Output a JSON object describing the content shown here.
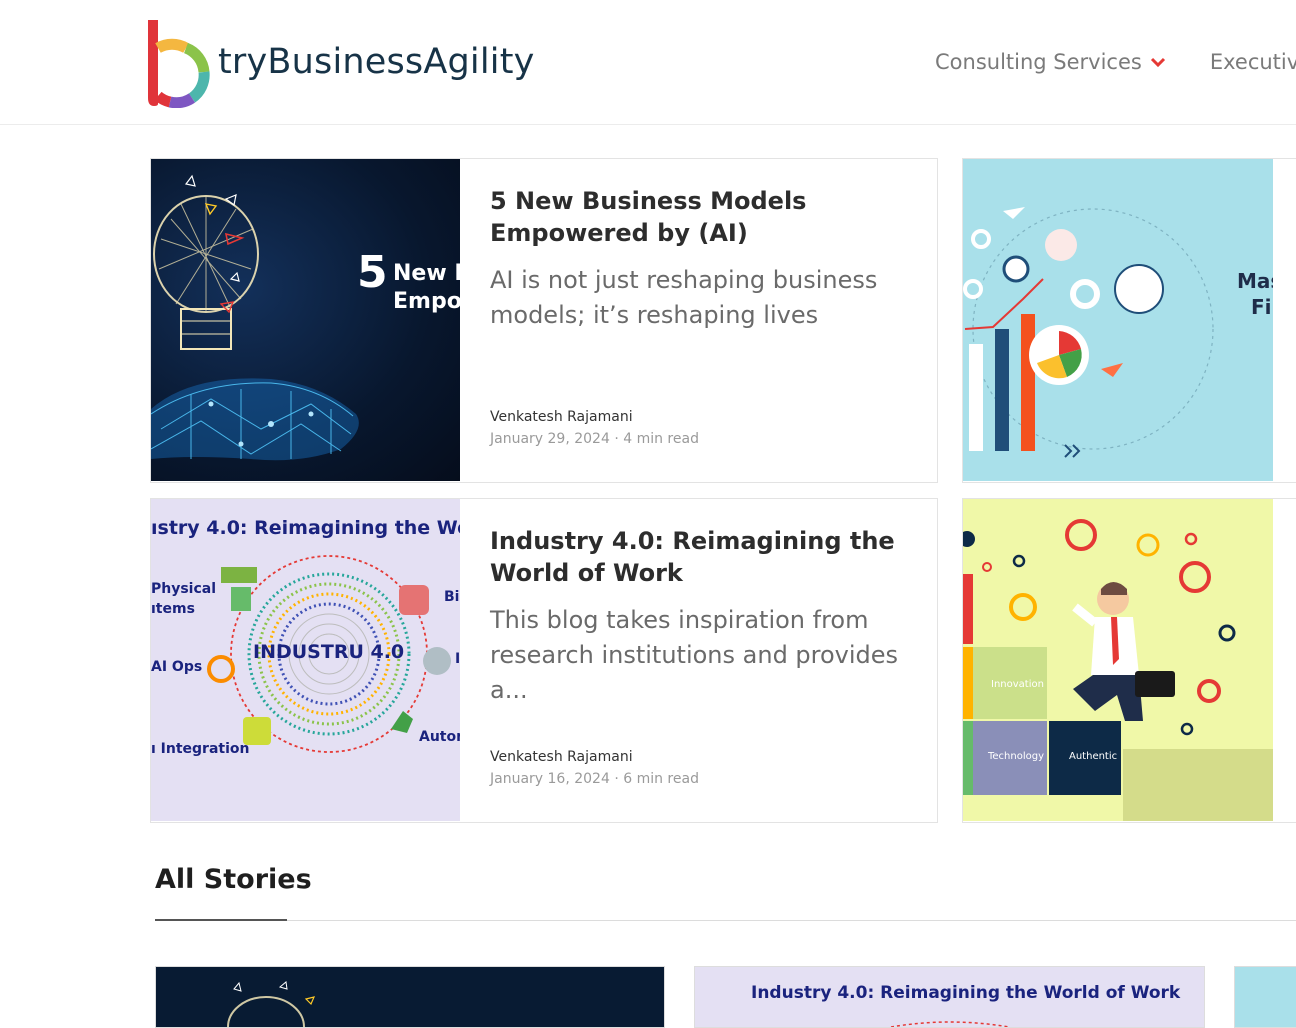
{
  "header": {
    "brand": "tryBusinessAgility",
    "nav": [
      {
        "label": "Consulting Services",
        "has_dropdown": true
      },
      {
        "label": "Executive E",
        "has_dropdown": false
      }
    ]
  },
  "featured": [
    {
      "title": "5 New Business Models Empowered by (AI)",
      "excerpt": "AI is not just reshaping business models; it’s reshaping lives",
      "author": "Venkatesh Rajamani",
      "meta": "January 29, 2024 · 4 min read",
      "thumb": {
        "number": "5",
        "line1": "New B",
        "line2": "Empow"
      }
    },
    {
      "title": "Industry 4.0: Reimagining the World of Work",
      "excerpt": "This blog takes inspiration from research institutions and provides a...",
      "author": "Venkatesh Rajamani",
      "meta": "January 16, 2024 · 6 min read",
      "thumb": {
        "heading": "ıstry 4.0: Reimagining the Wo",
        "center": "INDUSTRU 4.0",
        "labels": [
          "Physical",
          "ıtems",
          "AI Ops",
          "ı Integration",
          "Bi",
          "Auton",
          "I"
        ]
      }
    }
  ],
  "side_thumbs": [
    {
      "line1": "Mas",
      "line2": "Fi"
    },
    {
      "puzzle": [
        "Innovation",
        "Technology",
        "Authentic"
      ]
    }
  ],
  "all_stories": {
    "title": "All Stories",
    "cards": [
      {
        "thumb_text": ""
      },
      {
        "thumb_text": "Industry 4.0: Reimagining the World of Work"
      },
      {
        "thumb_text": ""
      }
    ]
  },
  "colors": {
    "brand_dark": "#173347",
    "accent_red": "#e53935",
    "nav_text": "#7a7a7a"
  }
}
